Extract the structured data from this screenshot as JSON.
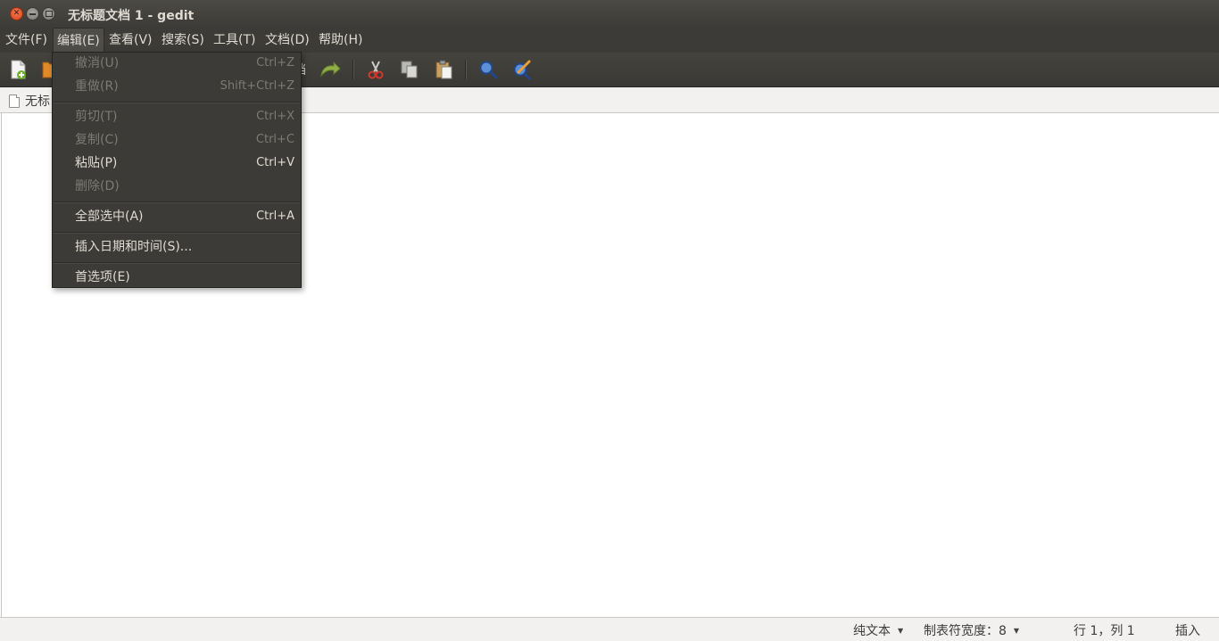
{
  "window": {
    "title": "无标题文档 1 - gedit"
  },
  "menubar": {
    "items": [
      {
        "label": "文件(F)"
      },
      {
        "label": "编辑(E)"
      },
      {
        "label": "查看(V)"
      },
      {
        "label": "搜索(S)"
      },
      {
        "label": "工具(T)"
      },
      {
        "label": "文档(D)"
      },
      {
        "label": "帮助(H)"
      }
    ]
  },
  "toolbar": {
    "partial_save_label": "档"
  },
  "tab": {
    "visible_label": "无标"
  },
  "edit_menu": {
    "items": [
      {
        "label": "撤消(U)",
        "accel": "Ctrl+Z",
        "enabled": false
      },
      {
        "label": "重做(R)",
        "accel": "Shift+Ctrl+Z",
        "enabled": false
      },
      {
        "label": "剪切(T)",
        "accel": "Ctrl+X",
        "enabled": false
      },
      {
        "label": "复制(C)",
        "accel": "Ctrl+C",
        "enabled": false
      },
      {
        "label": "粘贴(P)",
        "accel": "Ctrl+V",
        "enabled": true
      },
      {
        "label": "删除(D)",
        "accel": "",
        "enabled": false
      },
      {
        "label": "全部选中(A)",
        "accel": "Ctrl+A",
        "enabled": true
      },
      {
        "label": "插入日期和时间(S)...",
        "accel": "",
        "enabled": true
      },
      {
        "label": "首选项(E)",
        "accel": "",
        "enabled": true
      }
    ]
  },
  "statusbar": {
    "language": "纯文本",
    "tab_width": "制表符宽度：8",
    "position": "行 1，列 1",
    "mode": "插入"
  },
  "colors": {
    "chrome_dark": "#3c3b37",
    "menu_text": "#dfdbd2",
    "disabled_text": "#7c7a73",
    "close_button": "#e0592a"
  }
}
